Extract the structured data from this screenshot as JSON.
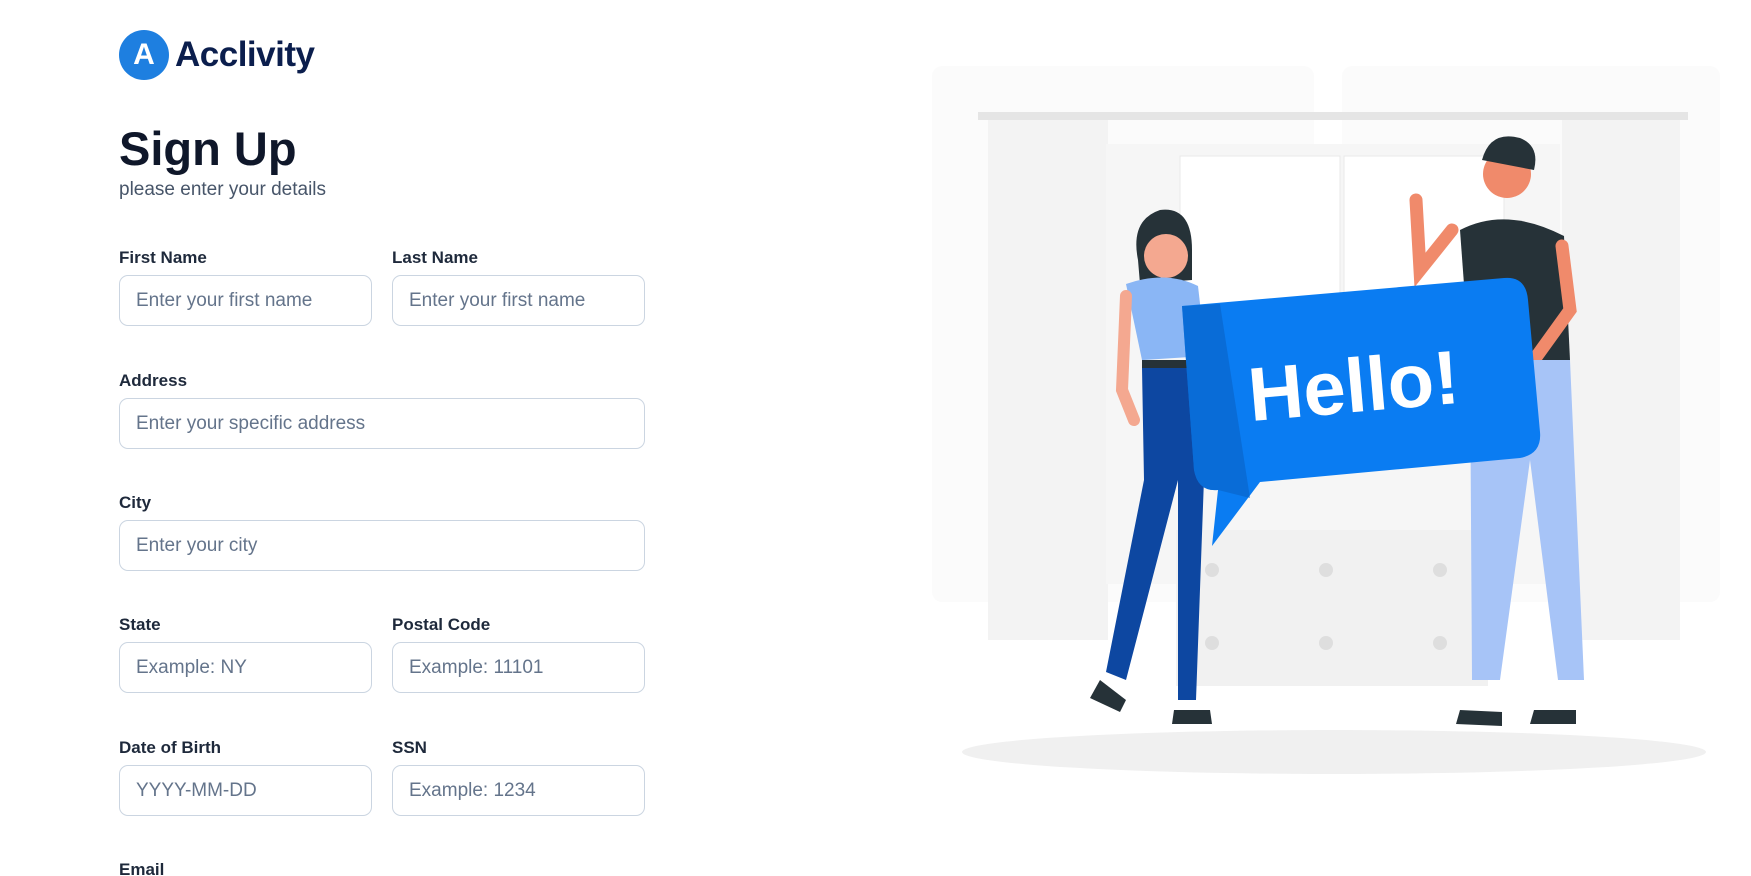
{
  "brand": {
    "logo_letter": "A",
    "name": "Acclivity",
    "accent": "#1e7fe0"
  },
  "page": {
    "title": "Sign Up",
    "subtitle": "please enter your details"
  },
  "form": {
    "first_name": {
      "label": "First Name",
      "placeholder": "Enter your first name",
      "value": ""
    },
    "last_name": {
      "label": "Last Name",
      "placeholder": "Enter your first name",
      "value": ""
    },
    "address": {
      "label": "Address",
      "placeholder": "Enter your specific address",
      "value": ""
    },
    "city": {
      "label": "City",
      "placeholder": "Enter your city",
      "value": ""
    },
    "state": {
      "label": "State",
      "placeholder": "Example: NY",
      "value": ""
    },
    "postal_code": {
      "label": "Postal Code",
      "placeholder": "Example: 11101",
      "value": ""
    },
    "dob": {
      "label": "Date of Birth",
      "placeholder": "YYYY-MM-DD",
      "value": ""
    },
    "ssn": {
      "label": "SSN",
      "placeholder": "Example: 1234",
      "value": ""
    },
    "email": {
      "label": "Email"
    }
  },
  "illustration": {
    "speech_text": "Hello!"
  }
}
